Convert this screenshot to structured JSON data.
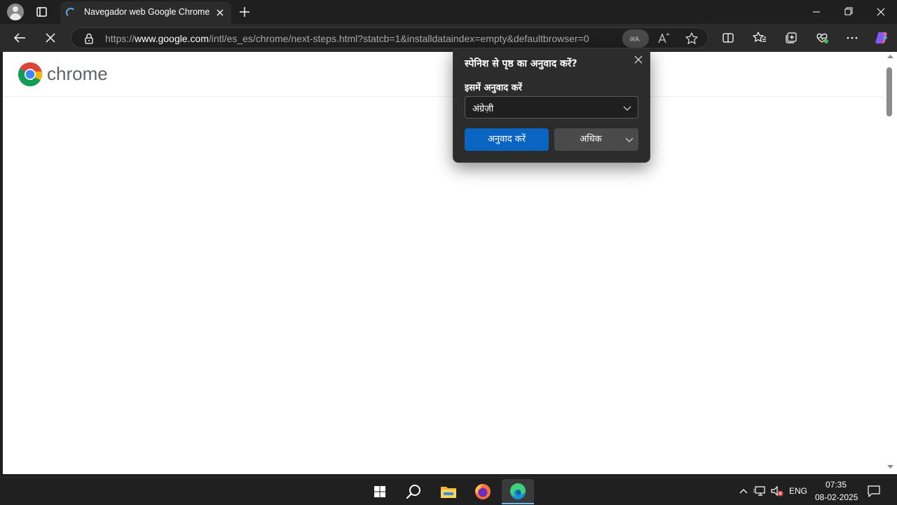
{
  "browser": {
    "tab": {
      "title": "Navegador web Google Chrome"
    },
    "address_bar": {
      "prefix": "https://",
      "domain": "www.google.com",
      "path": "/intl/es_es/chrome/next-steps.html?statcb=1&installdataindex=empty&defaultbrowser=0"
    }
  },
  "page": {
    "brand": "chrome"
  },
  "translate_popup": {
    "title": "स्पेनिश से पृष्ठ का अनुवाद करें?",
    "label": "इसमें अनुवाद करें",
    "selected_language": "अंग्रेज़ी",
    "translate_button": "अनुवाद करें",
    "more_button": "अधिक"
  },
  "taskbar": {
    "language": "ENG",
    "time": "07:35",
    "date": "08-02-2025"
  },
  "icons": [
    "profile-icon",
    "tab-actions-icon",
    "loading-spinner-icon",
    "close-icon",
    "new-tab-icon",
    "minimize-icon",
    "restore-icon",
    "back-icon",
    "stop-icon",
    "lock-icon",
    "translate-icon",
    "read-aloud-icon",
    "favorite-star-icon",
    "split-screen-icon",
    "favorites-icon",
    "collections-icon",
    "browser-essentials-icon",
    "more-icon",
    "copilot-icon",
    "windows-start-icon",
    "search-icon",
    "file-explorer-icon",
    "firefox-icon",
    "edge-icon",
    "chevron-up-icon",
    "network-icon",
    "volume-muted-icon",
    "notifications-icon"
  ]
}
